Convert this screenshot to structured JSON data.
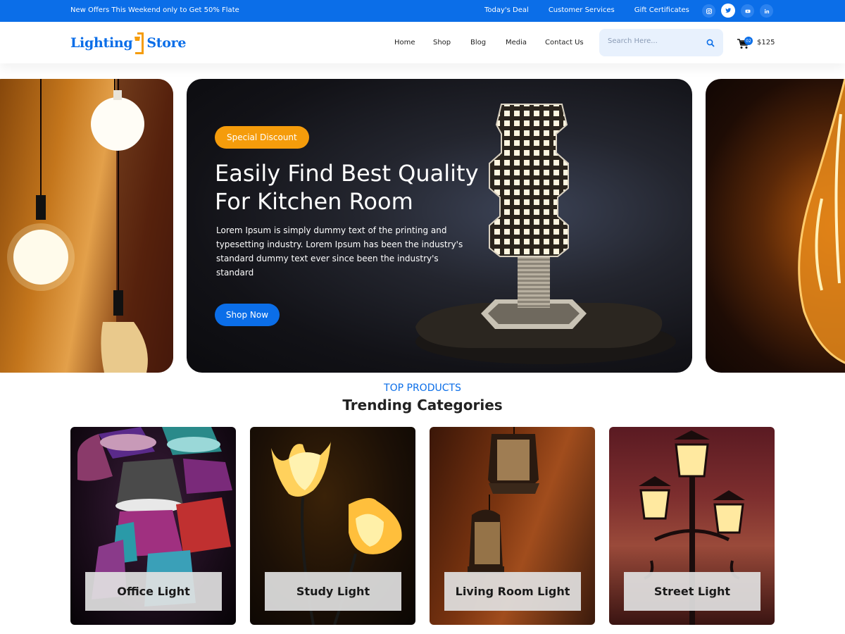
{
  "topbar": {
    "offer": "New Offers This Weekend only to Get 50% Flate",
    "links": [
      "Today's Deal",
      "Customer Services",
      "Gift Certificates"
    ],
    "social": [
      "instagram-icon",
      "twitter-icon",
      "youtube-icon",
      "linkedin-icon"
    ]
  },
  "header": {
    "logo_left": "Lighting",
    "logo_right": "Store",
    "nav": [
      "Home",
      "Shop",
      "Blog",
      "Media",
      "Contact Us"
    ],
    "search_placeholder": "Search Here...",
    "cart_count": "02",
    "cart_total": "$125"
  },
  "hero": {
    "badge": "Special Discount",
    "title_line1": "Easily Find Best Quality",
    "title_line2": "For Kitchen Room",
    "text": "Lorem Ipsum is simply dummy text of the printing and typesetting industry. Lorem Ipsum has been the industry's standard dummy text ever since  been the industry's standard",
    "button": "Shop Now"
  },
  "section": {
    "subtitle": "TOP PRODUCTS",
    "title": "Trending Categories",
    "categories": [
      "Office Light",
      "Study Light",
      "Living Room Light",
      "Street Light"
    ]
  },
  "colors": {
    "primary": "#0b6ee8",
    "accent": "#f59c0b"
  }
}
